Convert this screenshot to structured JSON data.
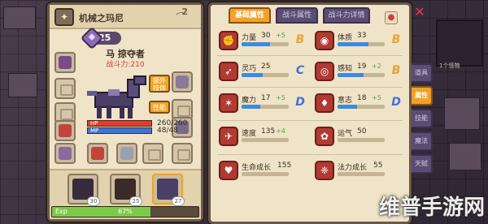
{
  "left_panel": {
    "title": "机械之玛尼",
    "level": "25",
    "pet_name": "马 掠夺者",
    "combat_power": "战斗力:210",
    "wardrobe_count": "2",
    "buttons": {
      "awaken": "额外\n技体",
      "ability": "性能"
    },
    "hp": {
      "label": "HP",
      "value": "260/260",
      "ratio": 1.0
    },
    "mp": {
      "label": "MP",
      "value": "48/48",
      "ratio": 1.0
    },
    "pets": [
      {
        "level": "30"
      },
      {
        "level": "25"
      },
      {
        "level": "27"
      }
    ],
    "exp": {
      "label": "Exp",
      "percent": "67%",
      "ratio": 0.67
    }
  },
  "right_panel": {
    "tabs": [
      "基础属性",
      "战斗属性",
      "战斗力详情"
    ],
    "active_tab": 0,
    "stats": [
      {
        "label": "力量",
        "value": "30",
        "bonus": "+5",
        "grade": "B",
        "fill": 0.6
      },
      {
        "label": "体质",
        "value": "33",
        "bonus": "",
        "grade": "B",
        "fill": 0.65
      },
      {
        "label": "灵巧",
        "value": "25",
        "bonus": "",
        "grade": "C",
        "fill": 0.45
      },
      {
        "label": "感知",
        "value": "19",
        "bonus": "+2",
        "grade": "B",
        "fill": 0.55
      },
      {
        "label": "魔力",
        "value": "17",
        "bonus": "+5",
        "grade": "D",
        "fill": 0.4
      },
      {
        "label": "意志",
        "value": "18",
        "bonus": "+5",
        "grade": "D",
        "fill": 0.42
      },
      {
        "label": "速度",
        "value": "135",
        "bonus": "+4",
        "grade": "",
        "fill": 0
      },
      {
        "label": "运气",
        "value": "50",
        "bonus": "",
        "grade": "",
        "fill": 0
      },
      {
        "label": "生命成长",
        "value": "155",
        "bonus": "",
        "grade": "",
        "fill": 0
      },
      {
        "label": "法力成长",
        "value": "55",
        "bonus": "",
        "grade": "",
        "fill": 0
      }
    ]
  },
  "side_tabs": [
    "道具",
    "属性",
    "技能",
    "魔法",
    "天赋"
  ],
  "active_side_tab": 1,
  "map_label": "1个怪物",
  "watermark": "维普手游网",
  "colors": {
    "accent": "#f2a226",
    "panel": "#efe3c8",
    "tab_inactive": "#5a4d72",
    "hp": "#e53a2e",
    "mp": "#3a75e0",
    "exp": "#7ec94a",
    "stat_icon": "#b13a33"
  }
}
